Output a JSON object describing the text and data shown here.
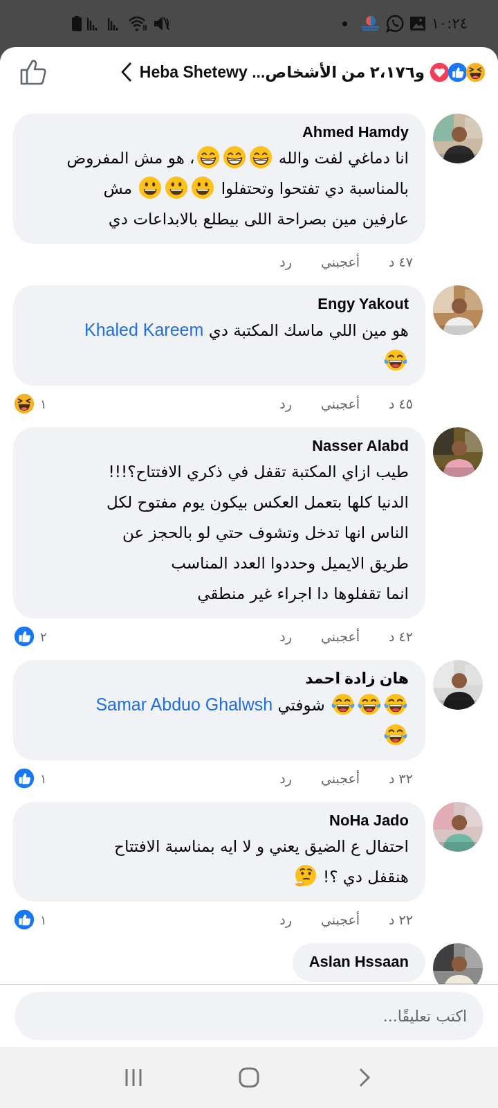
{
  "status_bar": {
    "time": "١٠:٢٤"
  },
  "header": {
    "reactions": [
      {
        "kind": "haha"
      },
      {
        "kind": "like"
      },
      {
        "kind": "love"
      }
    ],
    "title": "و٢،١٧٦ من الأشخاص... Heba Shetewy"
  },
  "comments": [
    {
      "author": "Ahmed Hamdy",
      "lines": [
        [
          {
            "kind": "text",
            "text": "انا دماغي لفت والله "
          },
          {
            "kind": "grin"
          },
          {
            "kind": "grin"
          },
          {
            "kind": "grin"
          },
          {
            "kind": "text",
            "text": "، هو مش المفروض"
          }
        ],
        [
          {
            "kind": "text",
            "text": "بالمناسبة دي تفتحوا وتحتفلوا "
          },
          {
            "kind": "smile"
          },
          {
            "kind": "smile"
          },
          {
            "kind": "smile"
          },
          {
            "kind": "text",
            "text": " مش"
          }
        ],
        [
          {
            "kind": "text",
            "text": "عارفين مين بصراحة اللى بيطلع بالابداعات دي"
          }
        ]
      ],
      "time": "٤٧ د",
      "like": "أعجبني",
      "reply": "رد"
    },
    {
      "author": "Engy Yakout",
      "lines": [
        [
          {
            "kind": "text",
            "text": "هو مين اللي ماسك المكتبة دي "
          },
          {
            "kind": "mention",
            "text": "Khaled Kareem"
          }
        ],
        [
          {
            "kind": "tears"
          }
        ]
      ],
      "time": "٤٥ د",
      "like": "أعجبني",
      "reply": "رد",
      "reaction": {
        "kind": "haha",
        "count": "١"
      }
    },
    {
      "author": "Nasser Alabd",
      "lines": [
        [
          {
            "kind": "text",
            "text": "طيب ازاي المكتبة تقفل في ذكري الافتتاح؟!!!"
          }
        ],
        [
          {
            "kind": "text",
            "text": "الدنيا كلها بتعمل العكس بيكون يوم مفتوح لكل"
          }
        ],
        [
          {
            "kind": "text",
            "text": "الناس انها تدخل وتشوف حتي لو بالحجز عن"
          }
        ],
        [
          {
            "kind": "text",
            "text": "طريق الايميل وحددوا العدد المناسب"
          }
        ],
        [
          {
            "kind": "text",
            "text": "انما تقفلوها دا اجراء غير منطقي"
          }
        ]
      ],
      "time": "٤٢ د",
      "like": "أعجبني",
      "reply": "رد",
      "reaction": {
        "kind": "like",
        "count": "٢"
      }
    },
    {
      "author": "هان زادة احمد",
      "lines": [
        [
          {
            "kind": "tears"
          },
          {
            "kind": "tears"
          },
          {
            "kind": "tears"
          },
          {
            "kind": "text",
            "text": " شوفتي  "
          },
          {
            "kind": "mention",
            "text": "Samar Abduo Ghalwsh"
          }
        ],
        [
          {
            "kind": "tears"
          }
        ]
      ],
      "time": "٣٢ د",
      "like": "أعجبني",
      "reply": "رد",
      "reaction": {
        "kind": "like",
        "count": "١"
      }
    },
    {
      "author": "NoHa Jado",
      "lines": [
        [
          {
            "kind": "text",
            "text": "احتفال ع الضيق يعني و لا ايه بمناسبة الافتتاح"
          }
        ],
        [
          {
            "kind": "text",
            "text": "هنقفل دي ؟! "
          },
          {
            "kind": "thinking"
          }
        ]
      ],
      "time": "٢٢ د",
      "like": "أعجبني",
      "reply": "رد",
      "reaction": {
        "kind": "like",
        "count": "١"
      }
    },
    {
      "author": "Aslan Hssaan"
    }
  ],
  "composer": {
    "placeholder": "اكتب تعليقًا..."
  }
}
